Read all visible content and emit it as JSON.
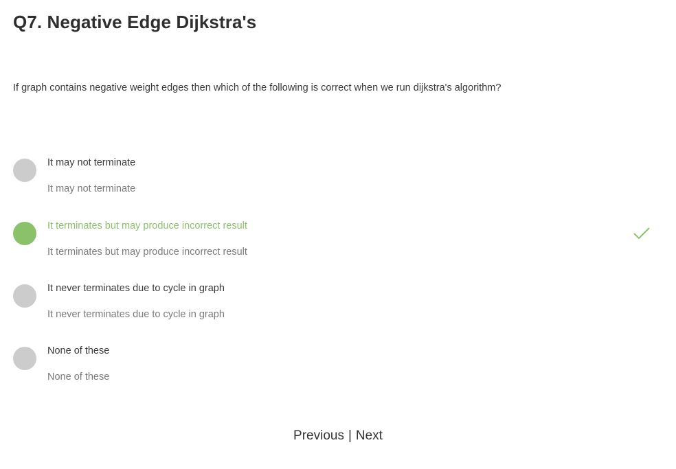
{
  "quiz": {
    "title": "Q7. Negative Edge Dijkstra's",
    "question": "If graph contains negative weight edges then which of the following is correct when we run dijkstra's algorithm?",
    "options": [
      {
        "label": "It may not terminate",
        "sublabel": "It may not terminate",
        "selected": false,
        "correct": false
      },
      {
        "label": "It terminates but may produce incorrect result",
        "sublabel": "It terminates but may produce incorrect result",
        "selected": true,
        "correct": true,
        "status_icon": "checkmark-icon"
      },
      {
        "label": "It never terminates due to cycle in graph",
        "sublabel": "It never terminates due to cycle in graph",
        "selected": false,
        "correct": false
      },
      {
        "label": "None of these",
        "sublabel": "None of these",
        "selected": false,
        "correct": false
      }
    ]
  },
  "nav": {
    "previous_label": "Previous",
    "separator": "|",
    "next_label": "Next"
  },
  "colors": {
    "correct_green": "#8bc16b",
    "radio_gray": "#cccccc",
    "title_text": "#2f2f2f",
    "body_text": "#3a3a3a",
    "muted_text": "#7a7a7a"
  }
}
